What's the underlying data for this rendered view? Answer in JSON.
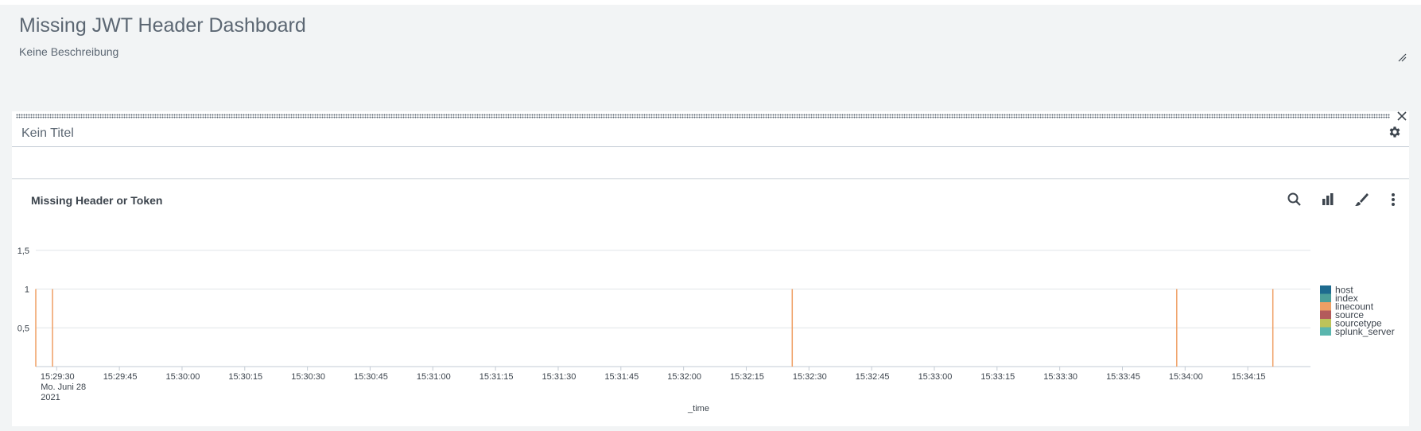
{
  "dashboard": {
    "title": "Missing JWT Header Dashboard",
    "description": "Keine Beschreibung"
  },
  "panel": {
    "title": "Kein Titel"
  },
  "viz": {
    "title": "Missing Header or Token",
    "tools": [
      "search-icon",
      "bar-chart-icon",
      "brush-icon",
      "more-vertical-icon"
    ]
  },
  "chart_data": {
    "type": "column",
    "title": "Missing Header or Token",
    "xlabel": "_time",
    "ylabel": "",
    "x_start": "15:29:25",
    "x_end": "15:34:30",
    "xtick_labels": [
      "15:29:30",
      "15:29:45",
      "15:30:00",
      "15:30:15",
      "15:30:30",
      "15:30:45",
      "15:31:00",
      "15:31:15",
      "15:31:30",
      "15:31:45",
      "15:32:00",
      "15:32:15",
      "15:32:30",
      "15:32:45",
      "15:33:00",
      "15:33:15",
      "15:33:30",
      "15:33:45",
      "15:34:00",
      "15:34:15"
    ],
    "xtick_sublabel": [
      "Mo. Juni 28",
      "2021"
    ],
    "yticks": [
      "0,5",
      "1",
      "1,5"
    ],
    "ytick_values": [
      0.5,
      1,
      1.5
    ],
    "ylim": [
      0,
      2
    ],
    "grid": true,
    "legend_position": "right",
    "series": [
      {
        "name": "host",
        "color": "#1e6b8f"
      },
      {
        "name": "index",
        "color": "#4c9f9a"
      },
      {
        "name": "linecount",
        "color": "#ef9f64",
        "points": [
          {
            "x": "15:29:25",
            "y": 1
          },
          {
            "x": "15:29:29",
            "y": 1
          },
          {
            "x": "15:32:26",
            "y": 1
          },
          {
            "x": "15:33:58",
            "y": 1
          },
          {
            "x": "15:34:21",
            "y": 1
          }
        ]
      },
      {
        "name": "source",
        "color": "#b35b5b"
      },
      {
        "name": "sourcetype",
        "color": "#bcc35a"
      },
      {
        "name": "splunk_server",
        "color": "#5ab6ae"
      }
    ]
  }
}
